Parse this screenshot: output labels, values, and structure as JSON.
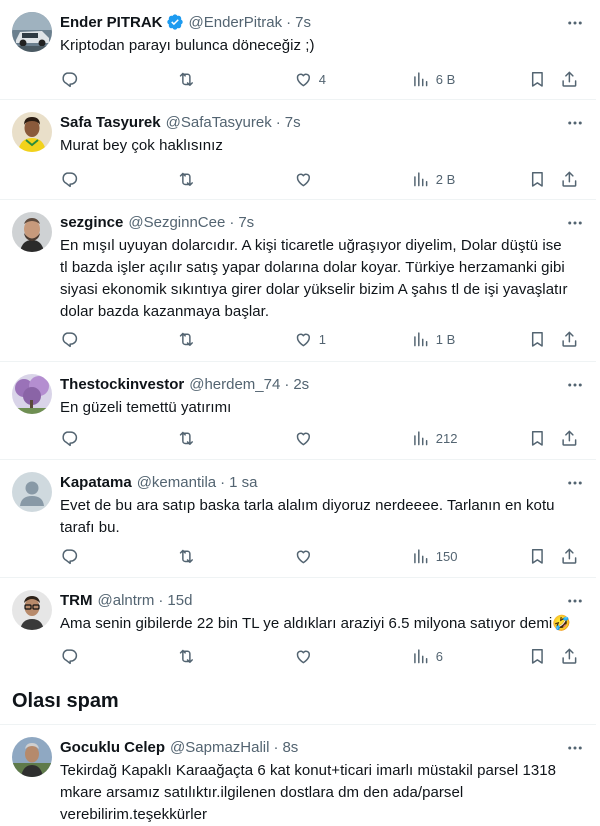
{
  "accent_color": "#1d9bf0",
  "text_color": "#0f1419",
  "muted_color": "#536471",
  "tweets": [
    {
      "name": "Ender PITRAK",
      "verified": true,
      "handle": "@EnderPitrak",
      "time": "7s",
      "lines": [
        "Kriptodan parayı bulunca döneceğiz ;)"
      ],
      "likes": "4",
      "views": "6 B",
      "avatar_icon": "car-photo-avatar"
    },
    {
      "name": "Safa Tasyurek",
      "verified": false,
      "handle": "@SafaTasyurek",
      "time": "7s",
      "lines": [
        "Murat bey çok haklısınız"
      ],
      "likes": "",
      "views": "2 B",
      "avatar_icon": "football-player-avatar"
    },
    {
      "name": "sezgince",
      "verified": false,
      "handle": "@SezginnCee",
      "time": "7s",
      "lines": [
        "En mışıl uyuyan dolarcıdır. A kişi ticaretle uğraşıyor  diyelim, Dolar düştü ise",
        "tl bazda işler açılır satış yapar dolarına dolar koyar. Türkiye herzamanki gibi",
        "siyasi ekonomik sıkıntıya girer dolar yükselir bizim A şahıs tl de işi yavaşlatır",
        "dolar bazda kazanmaya başlar."
      ],
      "likes": "1",
      "views": "1 B",
      "avatar_icon": "man-portrait-avatar"
    },
    {
      "name": "Thestockinvestor",
      "verified": false,
      "handle": "@herdem_74",
      "time": "2s",
      "lines": [
        "En güzeli temettü yatırımı"
      ],
      "likes": "",
      "views": "212",
      "avatar_icon": "purple-tree-avatar"
    },
    {
      "name": "Kapatama",
      "verified": false,
      "handle": "@kemantila",
      "time": "1 sa",
      "lines": [
        "Evet de bu ara satıp baska tarla alalım diyoruz nerdeeee. Tarlanın en kotu",
        "tarafı bu."
      ],
      "likes": "",
      "views": "150",
      "avatar_icon": "default-user-avatar"
    },
    {
      "name": "TRM",
      "verified": false,
      "handle": "@alntrm",
      "time": "15d",
      "lines": [
        "Ama senin gibilerde 22 bin TL ye aldıkları araziyi 6.5 milyona satıyor demi🤣"
      ],
      "likes": "",
      "views": "6",
      "avatar_icon": "man-with-glasses-avatar"
    },
    {
      "name": "Gocuklu Celep",
      "verified": false,
      "handle": "@SapmazHalil",
      "time": "8s",
      "lines": [
        "Tekirdağ Kapaklı Karaağaçta 6 kat konut+ticari imarlı müstakil parsel 1318",
        "mkare arsamız satılıktır.ilgilenen dostlara dm den ada/parsel",
        "verebilirim.teşekkürler"
      ],
      "likes": "",
      "views": "",
      "avatar_icon": "man-outdoor-avatar"
    }
  ],
  "spam_heading": "Olası spam",
  "separator": "·"
}
